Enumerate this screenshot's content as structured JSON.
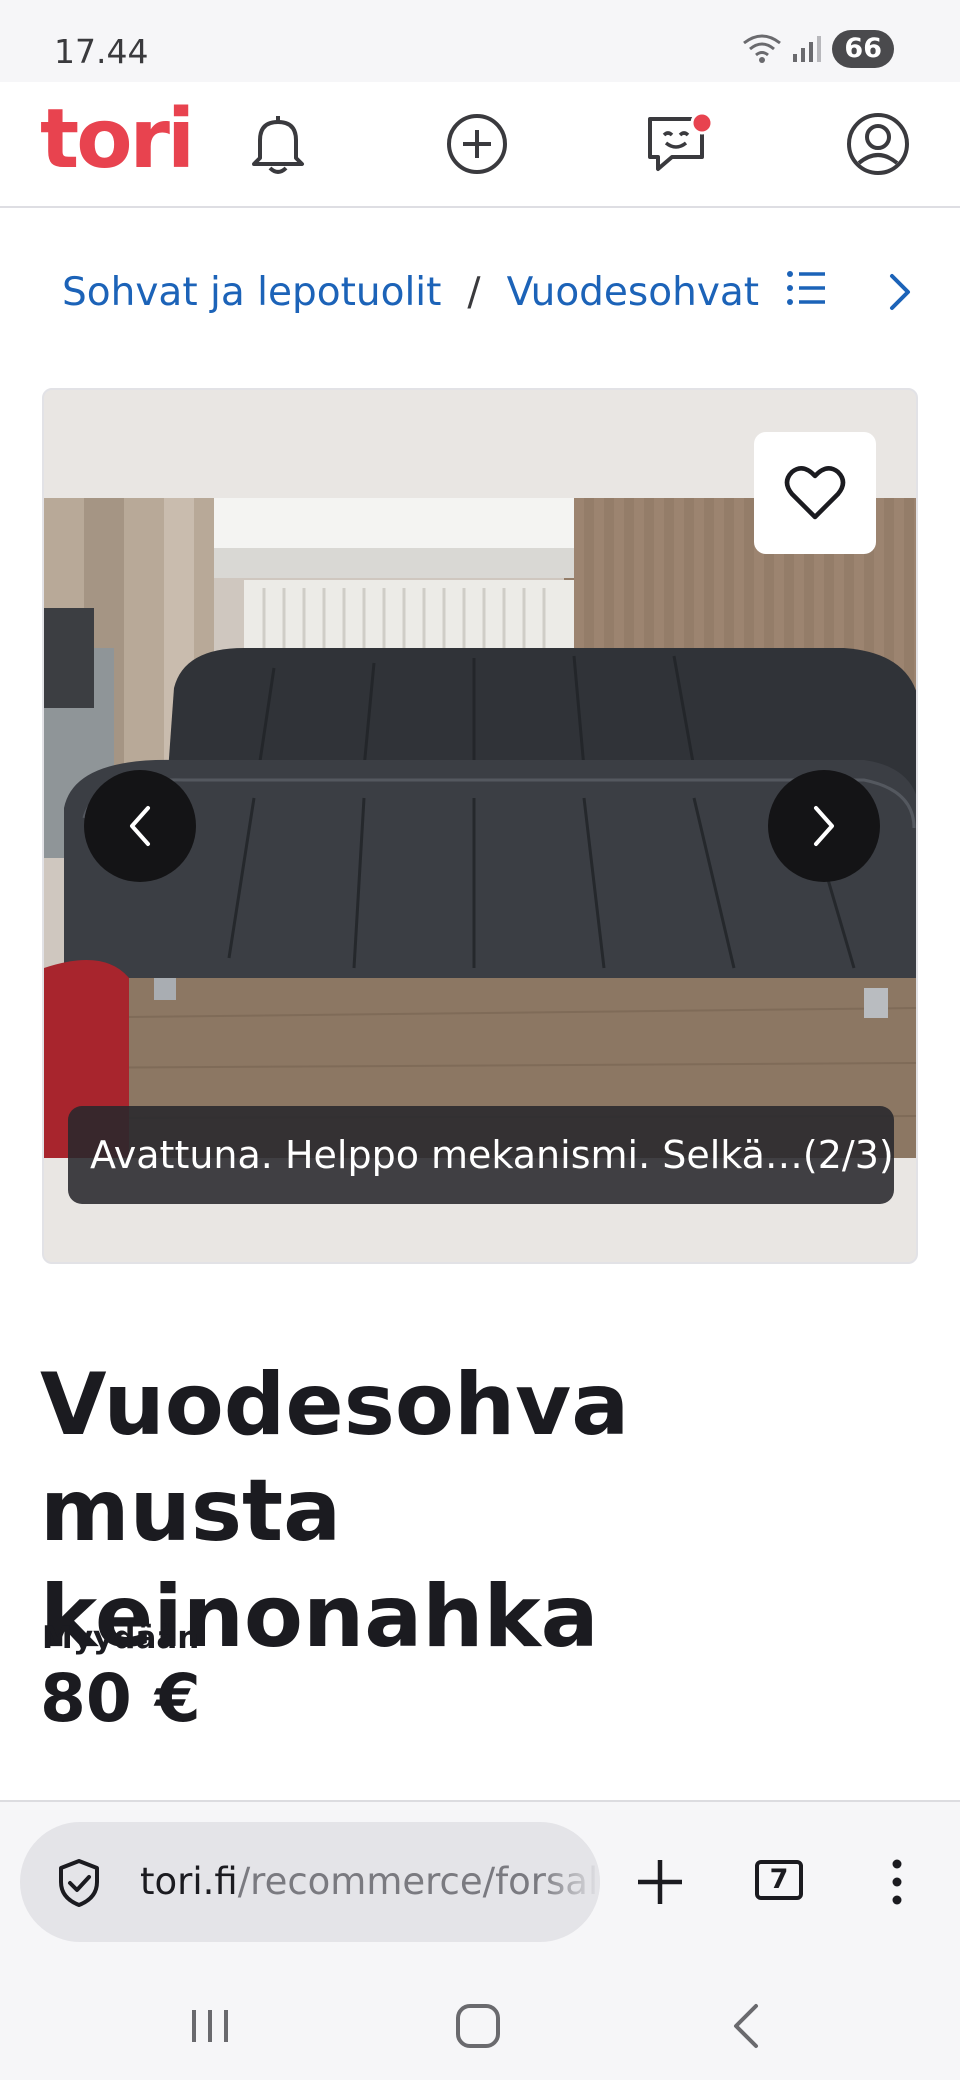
{
  "status_bar": {
    "time": "17.44",
    "battery": "66"
  },
  "header": {
    "logo": "tori"
  },
  "breadcrumb": {
    "items": [
      "Sohvat ja lepotuolit",
      "Vuodesohvat"
    ],
    "separator": "/"
  },
  "gallery": {
    "caption": "Avattuna. Helppo mekanismi. Selkä…(2/3)"
  },
  "listing": {
    "title": "Vuodesohva musta keinonahka",
    "sale_type": "Myydään",
    "price": "80 €"
  },
  "browser": {
    "url_domain": "tori.fi",
    "url_path": "/recommerce/forsale",
    "tab_count": "7"
  },
  "colors": {
    "brand": "#e8434f",
    "link": "#1c63b8",
    "notification_dot": "#e8434f"
  },
  "icons": [
    "bell-icon",
    "add-circle-icon",
    "messages-icon",
    "profile-icon",
    "list-icon",
    "chevron-right-icon",
    "heart-icon",
    "chevron-left-icon",
    "shield-icon",
    "plus-icon",
    "more-icon"
  ]
}
